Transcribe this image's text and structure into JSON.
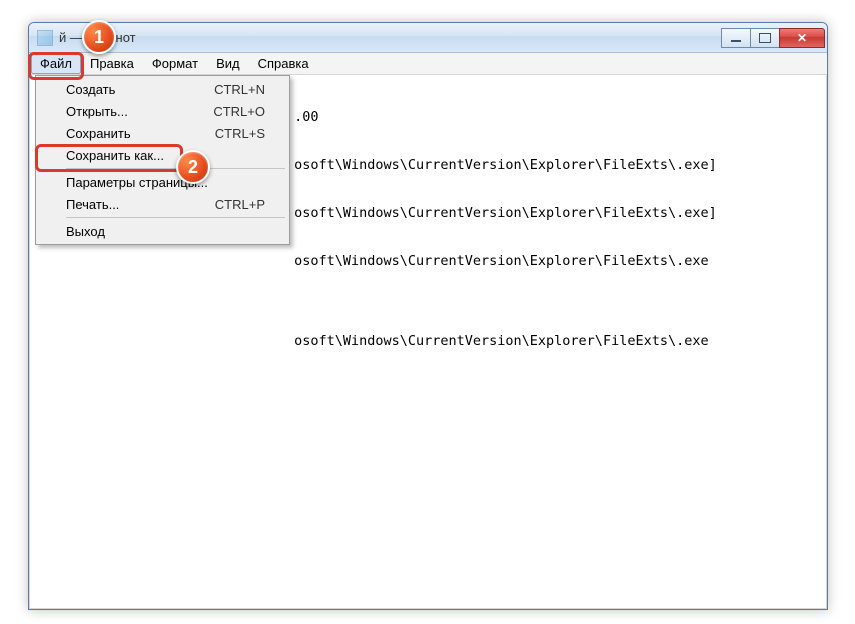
{
  "window": {
    "title": "             й — Блокнот"
  },
  "menubar": {
    "items": [
      "Файл",
      "Правка",
      "Формат",
      "Вид",
      "Справка"
    ],
    "active_index": 0
  },
  "dropdown": {
    "items": [
      {
        "label": "Создать",
        "shortcut": "CTRL+N"
      },
      {
        "label": "Открыть...",
        "shortcut": "CTRL+O"
      },
      {
        "label": "Сохранить",
        "shortcut": "CTRL+S"
      },
      {
        "label": "Сохранить как...",
        "shortcut": ""
      },
      {
        "sep": true
      },
      {
        "label": "Параметры страницы...",
        "shortcut": ""
      },
      {
        "label": "Печать...",
        "shortcut": "CTRL+P"
      },
      {
        "sep": true
      },
      {
        "label": "Выход",
        "shortcut": ""
      }
    ]
  },
  "text": {
    "lines": [
      "                                .00",
      "                                osoft\\Windows\\CurrentVersion\\Explorer\\FileExts\\.exe]",
      "                                osoft\\Windows\\CurrentVersion\\Explorer\\FileExts\\.exe]",
      "                                osoft\\Windows\\CurrentVersion\\Explorer\\FileExts\\.exe",
      "",
      "                                osoft\\Windows\\CurrentVersion\\Explorer\\FileExts\\.exe"
    ]
  },
  "callouts": {
    "one": "1",
    "two": "2"
  }
}
